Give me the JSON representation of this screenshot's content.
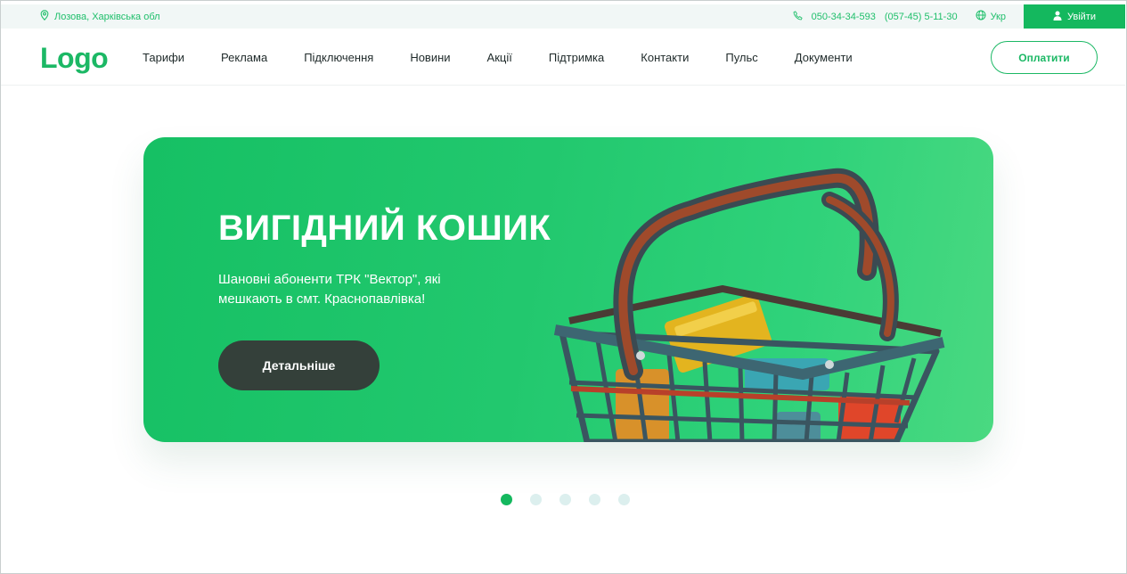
{
  "topbar": {
    "location": "Лозова, Харківська обл",
    "phone1": "050-34-34-593",
    "phone2": "(057-45) 5-11-30",
    "language": "Укр",
    "login_label": "Увійти"
  },
  "header": {
    "logo": "Logo",
    "nav": [
      "Тарифи",
      "Реклама",
      "Підключення",
      "Новини",
      "Акції",
      "Підтримка",
      "Контакти",
      "Пульс",
      "Документи"
    ],
    "pay_label": "Оплатити"
  },
  "banner": {
    "title": "ВИГІДНИЙ КОШИК",
    "text": "Шановні абоненти ТРК \"Вектор\", які мешкають в смт. Краснопавлівка!",
    "button_label": "Детальніше",
    "slides_total": 5,
    "active_slide": 1
  },
  "icons": {
    "location": "map-pin-icon",
    "phone": "phone-icon",
    "language": "globe-icon",
    "login": "user-icon"
  },
  "colors": {
    "accent": "#14b85e",
    "banner_dark_button": "#34403a",
    "topbar_bg": "#f1f7f6",
    "dot_inactive": "#dcefee"
  }
}
